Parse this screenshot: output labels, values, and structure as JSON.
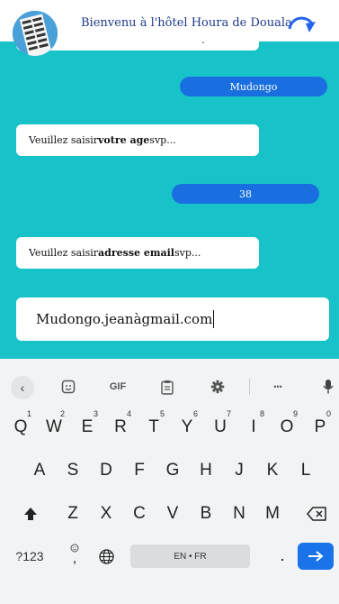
{
  "header": {
    "title": "Bienvenu à l'hôtel Houra de Douala",
    "logo_icon": "hotel-building-logo",
    "refresh_icon": "refresh-arrow-icon"
  },
  "chat": {
    "background_color": "#17c3c9",
    "top_partial_dot": ".",
    "messages": [
      {
        "from": "user",
        "text": "Mudongo"
      },
      {
        "from": "bot",
        "prefix": "Veuillez saisir ",
        "bold": "votre age",
        "suffix": " svp..."
      },
      {
        "from": "user",
        "text": "38"
      },
      {
        "from": "bot",
        "prefix": "Veuillez saisir ",
        "bold": "adresse email",
        "suffix": " svp..."
      }
    ],
    "input_value": "Mudongo.jeanàgmail.com"
  },
  "keyboard": {
    "toolbar": {
      "back_icon": "chevron-left-icon",
      "sticker_icon": "sticker-icon",
      "gif_label": "GIF",
      "clipboard_icon": "clipboard-icon",
      "settings_icon": "gear-icon",
      "more_label": "•••",
      "mic_icon": "microphone-icon"
    },
    "row1": [
      {
        "key": "Q",
        "hint": "1"
      },
      {
        "key": "W",
        "hint": "2"
      },
      {
        "key": "E",
        "hint": "3"
      },
      {
        "key": "R",
        "hint": "4"
      },
      {
        "key": "T",
        "hint": "5"
      },
      {
        "key": "Y",
        "hint": "6"
      },
      {
        "key": "U",
        "hint": "7"
      },
      {
        "key": "I",
        "hint": "8"
      },
      {
        "key": "O",
        "hint": "9"
      },
      {
        "key": "P",
        "hint": "0"
      }
    ],
    "row2": [
      "A",
      "S",
      "D",
      "F",
      "G",
      "H",
      "J",
      "K",
      "L"
    ],
    "row3": [
      "Z",
      "X",
      "C",
      "V",
      "B",
      "N",
      "M"
    ],
    "shift_icon": "shift-arrow-icon",
    "backspace_icon": "backspace-icon",
    "symbols_label": "?123",
    "emoji_icon": "emoji-icon",
    "comma_label": ",",
    "globe_icon": "globe-icon",
    "space_label": "EN • FR",
    "period_label": ".",
    "enter_icon": "arrow-right-icon",
    "accent_color": "#1a73e8"
  }
}
